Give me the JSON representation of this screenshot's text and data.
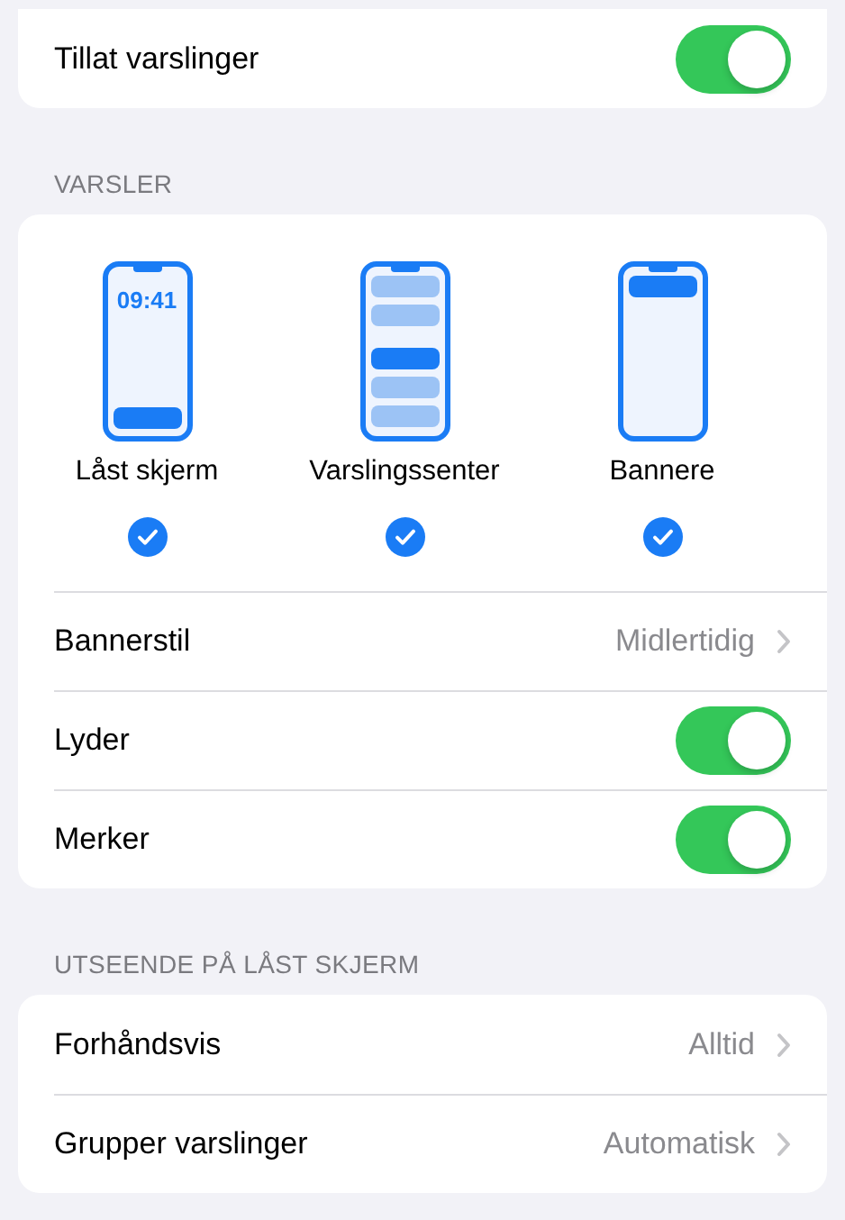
{
  "allow_notifications": {
    "label": "Tillat varslinger",
    "on": true
  },
  "alerts": {
    "header": "VARSLER",
    "styles": [
      {
        "kind": "lock",
        "label": "Låst skjerm",
        "time": "09:41",
        "selected": true
      },
      {
        "kind": "center",
        "label": "Varslingssenter",
        "selected": true
      },
      {
        "kind": "banner",
        "label": "Bannere",
        "selected": true
      }
    ],
    "rows": [
      {
        "kind": "link",
        "label": "Bannerstil",
        "value": "Midlertidig"
      },
      {
        "kind": "toggle",
        "label": "Lyder",
        "on": true
      },
      {
        "kind": "toggle",
        "label": "Merker",
        "on": true
      }
    ]
  },
  "lock_screen": {
    "header": "UTSEENDE PÅ LÅST SKJERM",
    "rows": [
      {
        "kind": "link",
        "label": "Forhåndsvis",
        "value": "Alltid"
      },
      {
        "kind": "link",
        "label": "Grupper varslinger",
        "value": "Automatisk"
      }
    ]
  }
}
